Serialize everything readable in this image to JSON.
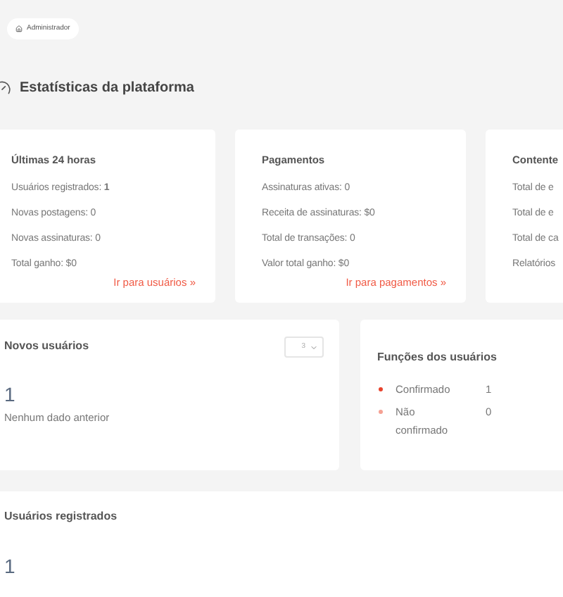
{
  "breadcrumb": {
    "label": "Administrador"
  },
  "page_title": "Estatísticas da plataforma",
  "stat_cards": [
    {
      "title": "Últimas 24 horas",
      "lines": [
        "Usuários registrados: **1**",
        "Novas postagens: 0",
        "Novas assinaturas: 0",
        "Total ganho: $0"
      ],
      "link": "Ir para usuários »"
    },
    {
      "title": "Pagamentos",
      "lines": [
        "Assinaturas ativas: 0",
        "Receita de assinaturas: $0",
        "Total de transações: 0",
        "Valor total ganho: $0"
      ],
      "link": "Ir para pagamentos »"
    },
    {
      "title": "Contente",
      "lines": [
        "Total de e",
        "Total de e",
        "Total de ca",
        "Relatórios"
      ]
    }
  ],
  "new_users": {
    "title": "Novos usuários",
    "select": {
      "value": "3"
    },
    "count": "1",
    "note": "Nenhum dado anterior"
  },
  "user_roles": {
    "title": "Funções dos usuários",
    "roles": [
      {
        "label": "Confirmado",
        "count": "1",
        "color": "#e8432d"
      },
      {
        "label": "Não confirmado",
        "count": "0",
        "color": "#f5a193"
      }
    ]
  },
  "registered_users": {
    "title": "Usuários registrados",
    "count": "1"
  }
}
